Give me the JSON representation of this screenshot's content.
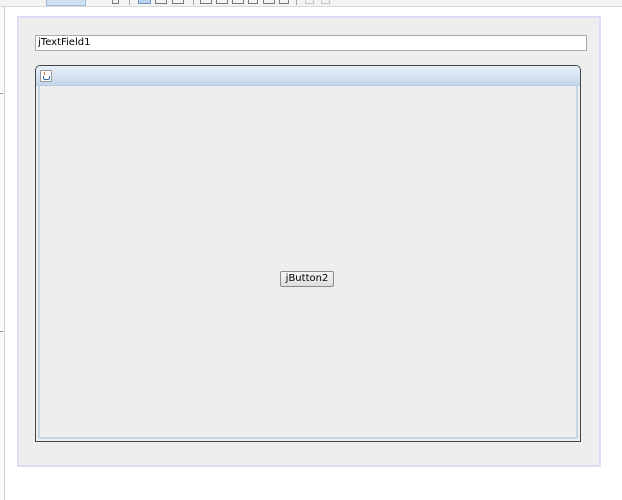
{
  "toolbar": {
    "icons": [
      "design-tab",
      "undo-icon",
      "selection-mode-icon",
      "connection-mode-icon",
      "preview-icon",
      "align-left-icon",
      "align-center-icon",
      "align-right-icon",
      "align-top-icon",
      "align-middle-icon",
      "align-bottom-icon",
      "resize-width-icon",
      "resize-height-icon"
    ]
  },
  "form": {
    "text_field_value": "jTextField1",
    "internal_frame": {
      "icon": "java-cup-icon"
    },
    "button_label": "jButton2"
  },
  "colors": {
    "form_background": "#eeeeee",
    "form_border": "#dcdcf6",
    "title_bar": "#d5e3f1",
    "frame_border": "#444444"
  }
}
